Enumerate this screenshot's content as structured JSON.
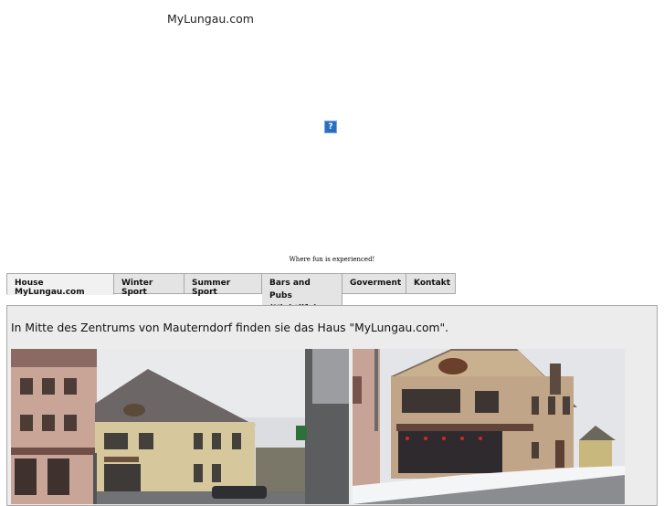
{
  "header": {
    "site_title": "MyLungau.com",
    "banner_placeholder": "?",
    "tagline": "Where fun is experienced!"
  },
  "tabs": [
    {
      "label": "House MyLungau.com",
      "active": true
    },
    {
      "label": "Winter Sport",
      "active": false
    },
    {
      "label": "Summer Sport",
      "active": false
    },
    {
      "label": "Bars and Pubs (Nightlife)",
      "active": false
    },
    {
      "label": "Goverment",
      "active": false
    },
    {
      "label": "Kontakt",
      "active": false
    }
  ],
  "content": {
    "intro_text": "In Mitte des Zentrums von Mauterndorf finden sie das Haus \"MyLungau.com\"."
  },
  "colors": {
    "tab_bg": "#e4e4e4",
    "active_tab_bg": "#f1f1f1",
    "content_bg": "#ececec",
    "border": "#a9a9a9"
  }
}
